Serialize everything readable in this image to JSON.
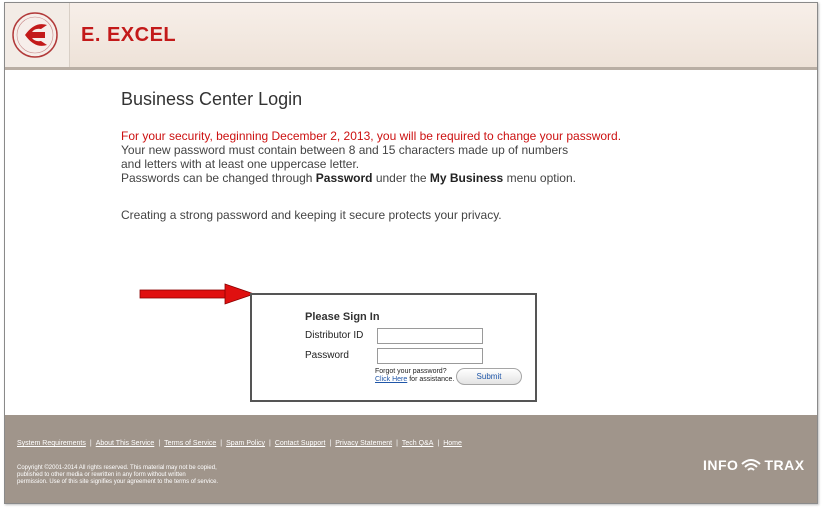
{
  "header": {
    "brand": "E. EXCEL",
    "logo_icon": "e-excel-logo-icon"
  },
  "main": {
    "title": "Business Center Login",
    "notice_red": "For your security, beginning December 2, 2013, you will be required to change your password.",
    "notice_line2": "Your new password must contain between 8 and 15 characters made up of numbers",
    "notice_line3": "and letters with at least one uppercase letter.",
    "notice_line4_pre": "Passwords can be changed through ",
    "notice_line4_bold1": "Password",
    "notice_line4_mid": " under the ",
    "notice_line4_bold2": "My Business",
    "notice_line4_post": " menu option.",
    "privacy_line": "Creating a strong password and keeping it secure protects your privacy.",
    "arrow_icon": "red-arrow-icon"
  },
  "login": {
    "heading": "Please Sign In",
    "distributor_label": "Distributor ID",
    "distributor_value": "",
    "password_label": "Password",
    "password_value": "",
    "forgot_text": "Forgot your password?",
    "click_here": "Click Here",
    "assistance": " for assistance.",
    "submit_label": "Submit"
  },
  "footer": {
    "links": [
      "System Requirements",
      "About This Service",
      "Terms of Service",
      "Spam Policy",
      "Contact Support",
      "Privacy Statement",
      "Tech Q&A",
      "Home"
    ],
    "copyright_line1": "Copyright ©2001-2014 All rights reserved. This material may not be copied,",
    "copyright_line2": "published to other media or rewritten in any form without written",
    "copyright_line3": "permission. Use of this site signifies your agreement to the terms of service.",
    "infotrax_left": "INFO",
    "infotrax_right": "TRAX",
    "infotrax_icon": "infotrax-logo-icon"
  },
  "colors": {
    "brand_red": "#c31a1a",
    "notice_red": "#cc1111",
    "footer_bg": "#a0958b",
    "link_blue": "#1f56a8"
  }
}
